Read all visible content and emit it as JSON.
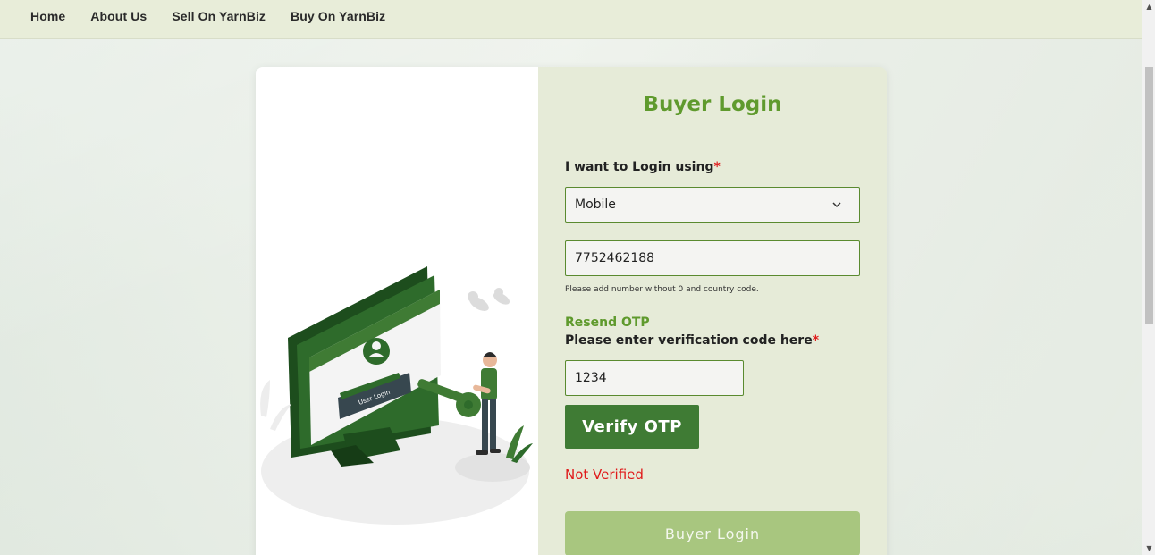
{
  "nav": {
    "items": [
      {
        "label": "Home"
      },
      {
        "label": "About Us"
      },
      {
        "label": "Sell On YarnBiz"
      },
      {
        "label": "Buy On YarnBiz"
      }
    ]
  },
  "illustration": {
    "screen_text": "User Login"
  },
  "form": {
    "title": "Buyer Login",
    "login_using_label": "I want to Login using",
    "required_mark": "*",
    "login_method_value": "Mobile",
    "mobile_value": "7752462188",
    "mobile_hint": "Please add number without 0 and country code.",
    "resend_otp_label": "Resend OTP",
    "verification_label": "Please enter verification code here",
    "otp_value": "1234",
    "verify_button_label": "Verify OTP",
    "verification_status": "Not Verified",
    "login_button_label": "Buyer Login"
  },
  "colors": {
    "accent": "#5f9a2d",
    "button_dark": "#3f7b34",
    "button_disabled": "#a8c67f",
    "error": "#e01b1b",
    "panel": "#e6ebd8"
  }
}
